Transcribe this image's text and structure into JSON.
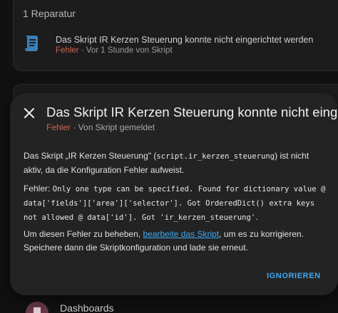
{
  "background": {
    "repairs_header": "1 Reparatur",
    "repair_item": {
      "title": "Das Skript IR Kerzen Steuerung konnte nicht eingerichtet werden",
      "severity": "Fehler",
      "meta": " · Vor 1 Stunde von Skript",
      "icon": "script-icon"
    },
    "dashboards_label": "Dashboards"
  },
  "dialog": {
    "title": "Das Skript IR Kerzen Steuerung konnte nicht eingerichtet werden",
    "severity": "Fehler",
    "source": " · Von Skript gemeldet",
    "para1": {
      "prefix": "Das Skript „IR Kerzen Steuerung\" (",
      "entity": "script.ir_kerzen_steuerung",
      "suffix": ") ist nicht aktiv, da die Konfiguration Fehler aufweist."
    },
    "para2": {
      "prefix": "Fehler:",
      "code": "Only one type can be specified. Found for dictionary value @ data['fields']['area']['selector']. Got OrderedDict() extra keys not allowed @ data['id']. Got 'ir_kerzen_steuerung'",
      "suffix": "."
    },
    "para3": {
      "prefix": "Um diesen Fehler zu beheben, ",
      "link": "bearbeite das Skript",
      "suffix": ", um es zu korrigieren. Speichere dann die Skriptkonfiguration und lade sie erneut."
    },
    "ignore_label": "IGNORIEREN"
  },
  "colors": {
    "accent": "#3fa9f5",
    "error": "#d06450",
    "dialog_bg": "#232323",
    "page_bg": "#111111"
  }
}
